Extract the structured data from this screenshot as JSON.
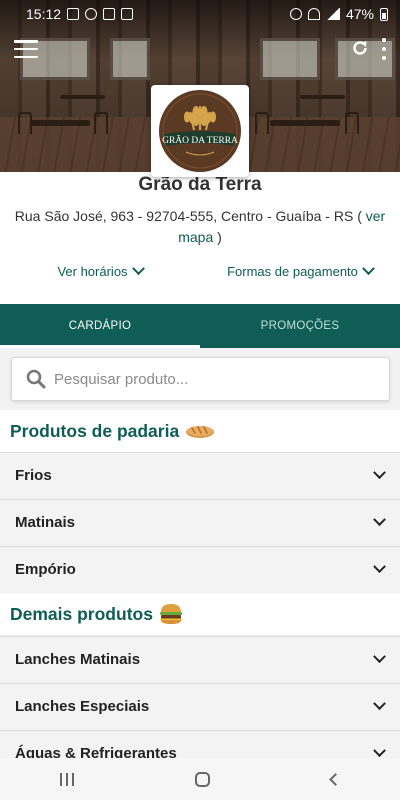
{
  "status_bar": {
    "time": "15:12",
    "battery": "47%"
  },
  "store": {
    "name": "Grão da Terra",
    "logo_text": "GRÃO DA TERRA",
    "address": "Rua São José, 963 - 92704-555, Centro - Guaíba - RS (",
    "map_link": "ver mapa",
    "address_close": ")",
    "hours_label": "Ver horários",
    "payment_label": "Formas de pagamento"
  },
  "tabs": [
    {
      "label": "CARDÁPIO",
      "active": true
    },
    {
      "label": "PROMOÇÕES",
      "active": false
    }
  ],
  "search": {
    "placeholder": "Pesquisar produto...",
    "value": ""
  },
  "sections": [
    {
      "title": "Produtos de padaria",
      "icon": "bread-icon",
      "items": [
        "Frios",
        "Matinais",
        "Empório"
      ]
    },
    {
      "title": "Demais produtos",
      "icon": "burger-icon",
      "items": [
        "Lanches Matinais",
        "Lanches Especiais",
        "Águas & Refrigerantes"
      ]
    }
  ],
  "colors": {
    "primary": "#0f5d54",
    "logo_bg": "#5a3a22",
    "logo_gold": "#d4a54a"
  },
  "icons": {
    "menu": "hamburger-icon",
    "refresh": "refresh-icon",
    "more": "more-vertical-icon",
    "search": "search-icon"
  }
}
